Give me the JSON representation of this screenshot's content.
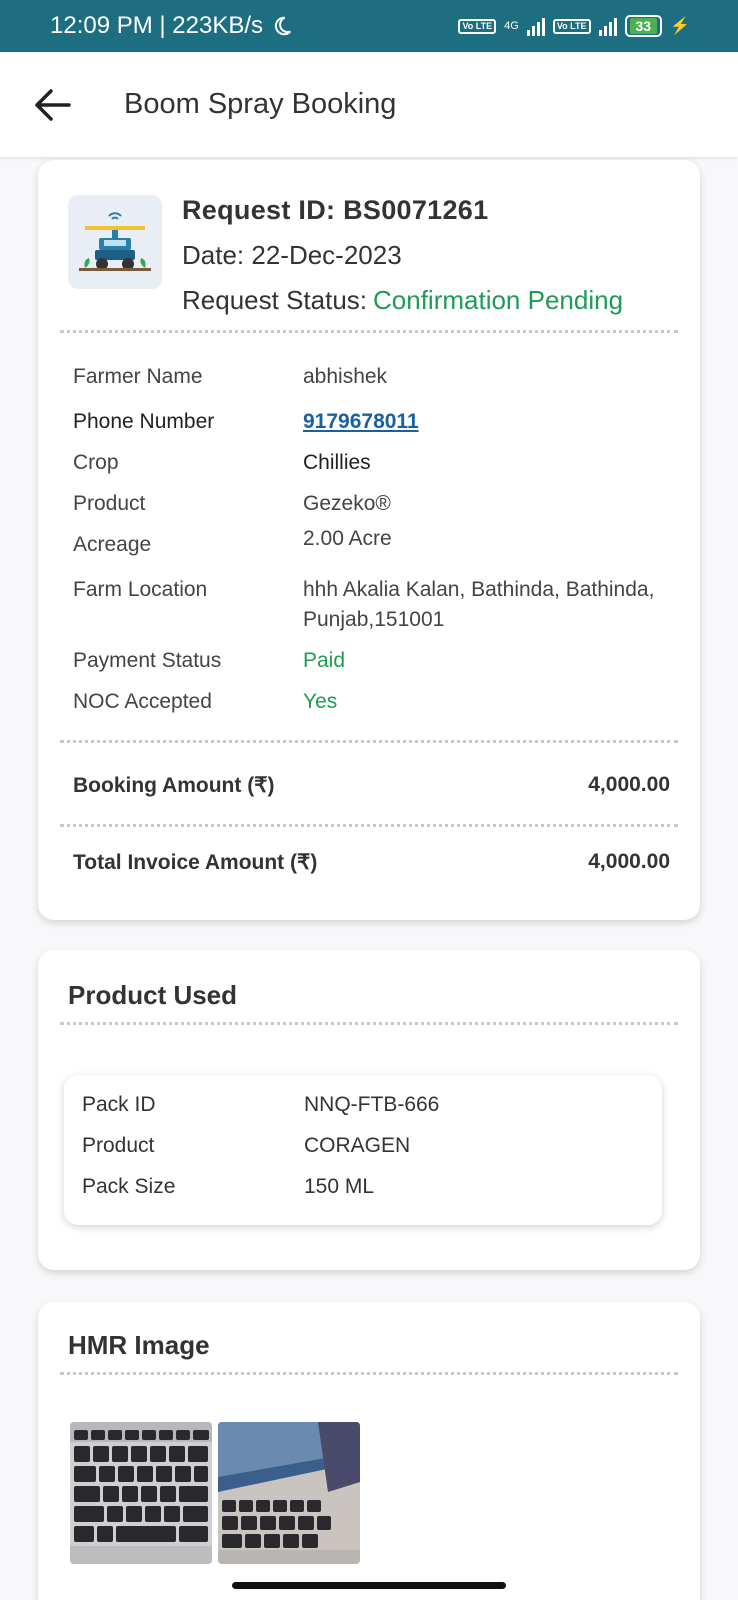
{
  "status_bar": {
    "time_speed": "12:09 PM | 223KB/s",
    "network": "4G",
    "volte": "Vo LTE",
    "battery": "33"
  },
  "app_bar": {
    "title": "Boom Spray Booking"
  },
  "booking": {
    "request_id": "Request ID: BS0071261",
    "date": "Date: 22-Dec-2023",
    "status_label": "Request Status:",
    "status_value": "Confirmation Pending",
    "details": [
      {
        "label": "Farmer Name",
        "value": "abhishek"
      },
      {
        "label": "Phone Number",
        "value": "9179678011"
      },
      {
        "label": "Crop",
        "value": "Chillies"
      },
      {
        "label": "Product",
        "value": "Gezeko®"
      },
      {
        "label": "Acreage",
        "value": "2.00 Acre"
      },
      {
        "label": "Farm Location",
        "value_line1": "hhh Akalia Kalan, Bathinda, Bathinda,",
        "value_line2": "Punjab,151001"
      },
      {
        "label": "Payment Status",
        "value": "Paid"
      },
      {
        "label": "NOC Accepted",
        "value": "Yes"
      }
    ],
    "booking_amount_label": "Booking Amount (₹)",
    "booking_amount_value": "4,000.00",
    "total_invoice_label": "Total Invoice Amount (₹)",
    "total_invoice_value": "4,000.00"
  },
  "product_used": {
    "title": "Product Used",
    "rows": [
      {
        "label": "Pack ID",
        "value": "NNQ-FTB-666"
      },
      {
        "label": "Product",
        "value": "CORAGEN"
      },
      {
        "label": "Pack Size",
        "value": "150 ML"
      }
    ]
  },
  "hmr": {
    "title": "HMR Image"
  },
  "colors": {
    "status_bar": "#1d6e80",
    "accent_green": "#1e9c55",
    "link_blue": "#1a5fa0"
  }
}
